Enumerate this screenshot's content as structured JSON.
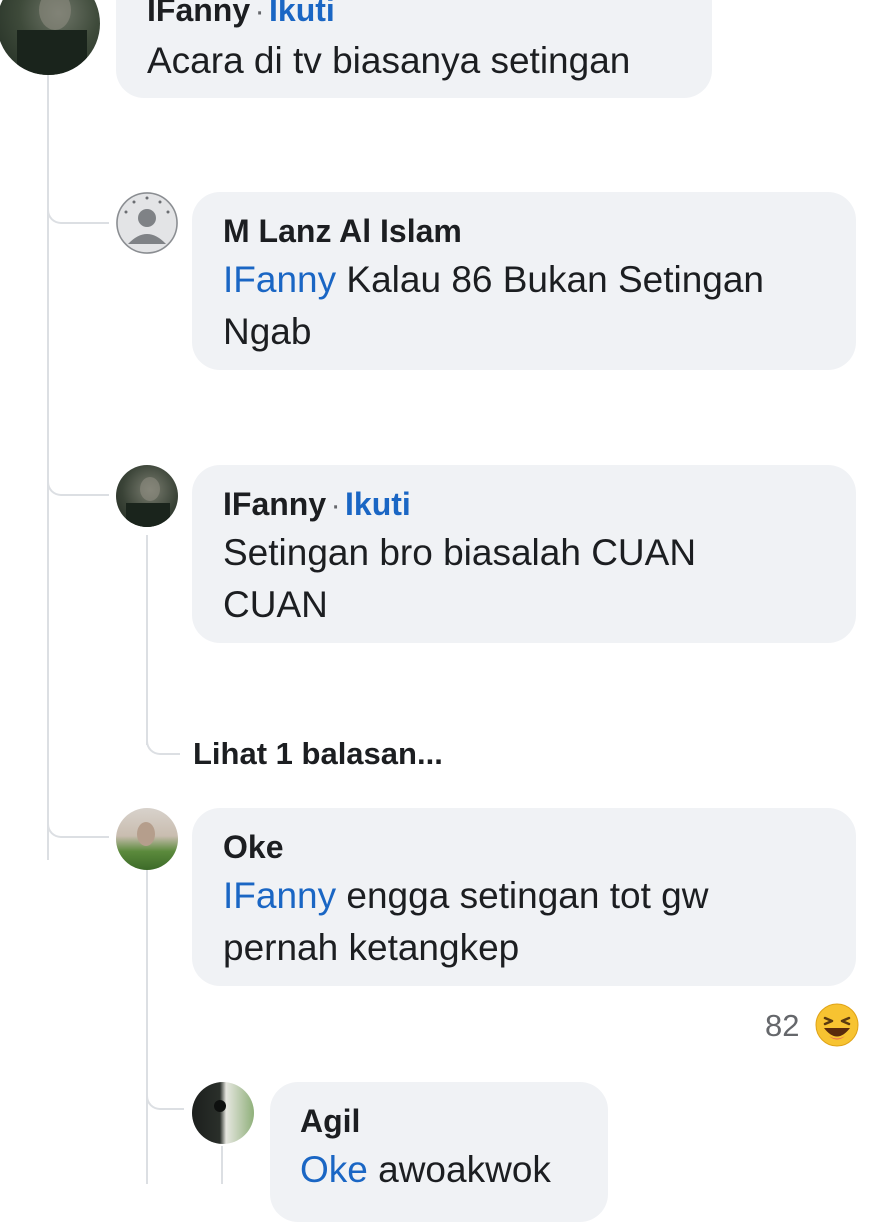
{
  "comments": [
    {
      "author": "IFanny",
      "follow_label": "Ikuti",
      "separator": "·",
      "text": "Acara di tv biasanya setingan"
    },
    {
      "author": "M Lanz Al Islam",
      "mention": "IFanny",
      "text": " Kalau 86 Bukan Setingan Ngab"
    },
    {
      "author": "IFanny",
      "follow_label": "Ikuti",
      "separator": "·",
      "text": "Setingan bro biasalah CUAN CUAN"
    },
    {
      "author": "Oke",
      "mention": "IFanny",
      "text": " engga setingan tot gw pernah ketangkep",
      "reaction_count": "82",
      "reaction_icon": "laugh-emoji-icon"
    },
    {
      "author": "Agil",
      "mention": "Oke",
      "text": " awoakwok"
    }
  ],
  "more_replies_label": "Lihat 1 balasan...",
  "colors": {
    "bubble": "#f0f2f5",
    "link": "#1a66c4",
    "thread_line": "#dcdfe3"
  }
}
